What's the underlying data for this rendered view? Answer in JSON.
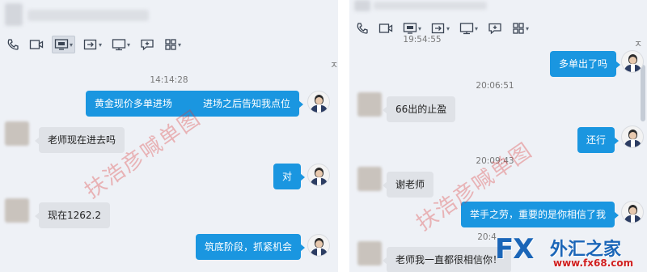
{
  "left": {
    "timestamp": "14:14:28",
    "messages": [
      {
        "dir": "out",
        "text": "黄金现价多单进场          进场之后告知我点位"
      },
      {
        "dir": "in",
        "text": "老师现在进去吗"
      },
      {
        "dir": "out",
        "text": "对"
      },
      {
        "dir": "in",
        "text": "现在1262.2"
      },
      {
        "dir": "out",
        "text": "筑底阶段，抓紧机会"
      }
    ],
    "collapse_glyph": "ㅈ"
  },
  "right": {
    "timestamps": [
      "19:54:55",
      "20:06:51",
      "20:09:43",
      "20:4"
    ],
    "messages": [
      {
        "dir": "out",
        "text": "多单出了吗"
      },
      {
        "dir": "in",
        "text": "66出的止盈"
      },
      {
        "dir": "out",
        "text": "还行"
      },
      {
        "dir": "in",
        "text": "谢老师"
      },
      {
        "dir": "out",
        "text": "举手之劳，重要的是你相信了我"
      },
      {
        "dir": "in",
        "text": "老师我一直都很相信你！"
      }
    ],
    "collapse_glyph": "ㅈ"
  },
  "toolbar_icons": [
    "phone-icon",
    "video-icon",
    "screen-share-icon",
    "transfer-icon",
    "remote-desktop-icon",
    "message-icon",
    "apps-icon"
  ],
  "watermark": "扶浩彦喊单图",
  "logo": {
    "fx": "FX",
    "cn": "外汇之家",
    "url": "www.fx68.com"
  },
  "colors": {
    "bubble_out": "#1a96e0",
    "bubble_in": "#dfe2e7",
    "panel_bg": "#eef1f6",
    "logo_blue": "#1b66b8",
    "url_red": "#d02020"
  }
}
